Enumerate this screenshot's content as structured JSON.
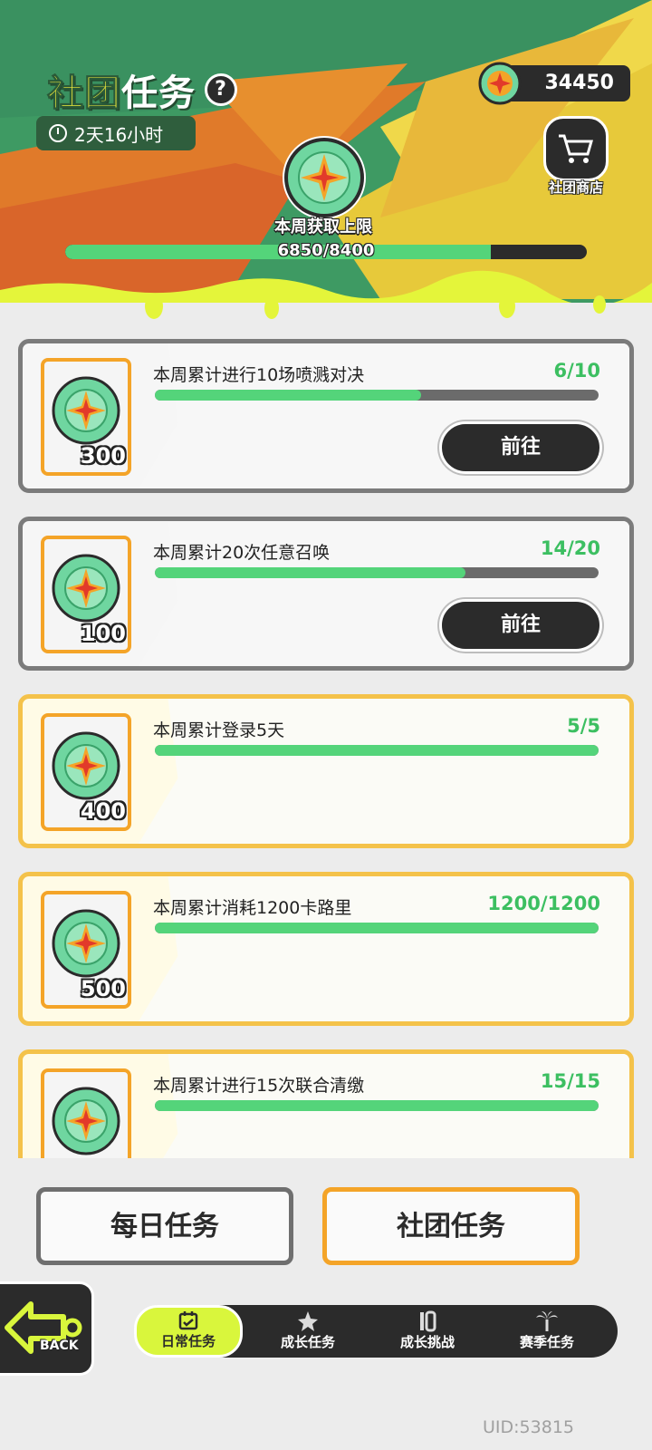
{
  "header": {
    "title_part1": "社团",
    "title_part2": "任务",
    "help_icon": "question-mark-icon",
    "timer": "2天16小时",
    "currency_amount": "34450",
    "shop_label": "社团商店",
    "cap_limit_label": "本周获取上限",
    "weekly_progress_text": "6850/8400",
    "weekly_progress_current": 6850,
    "weekly_progress_max": 8400
  },
  "tasks": [
    {
      "name": "本周累计进行10场喷溅对决",
      "progress": "6/10",
      "current": 6,
      "total": 10,
      "reward": "300",
      "button": "前往",
      "done": false
    },
    {
      "name": "本周累计20次任意召唤",
      "progress": "14/20",
      "current": 14,
      "total": 20,
      "reward": "100",
      "button": "前往",
      "done": false
    },
    {
      "name": "本周累计登录5天",
      "progress": "5/5",
      "current": 5,
      "total": 5,
      "reward": "400",
      "done": true
    },
    {
      "name": "本周累计消耗1200卡路里",
      "progress": "1200/1200",
      "current": 1200,
      "total": 1200,
      "reward": "500",
      "done": true
    },
    {
      "name": "本周累计进行15次联合清缴",
      "progress": "15/15",
      "current": 15,
      "total": 15,
      "reward": "",
      "done": true
    }
  ],
  "tabs": {
    "daily": "每日任务",
    "club": "社团任务"
  },
  "nav": {
    "back": "BACK",
    "items": [
      {
        "label": "日常任务",
        "icon": "calendar-icon"
      },
      {
        "label": "成长任务",
        "icon": "star-icon"
      },
      {
        "label": "成长挑战",
        "icon": "ten-badge-icon"
      },
      {
        "label": "赛季任务",
        "icon": "palm-tree-icon"
      }
    ]
  },
  "footer": {
    "uid": "UID:53815"
  },
  "colors": {
    "accent_green": "#54d47a",
    "accent_orange": "#f4a428",
    "accent_yellow": "#d9f63c",
    "dark": "#2b2b2b"
  }
}
